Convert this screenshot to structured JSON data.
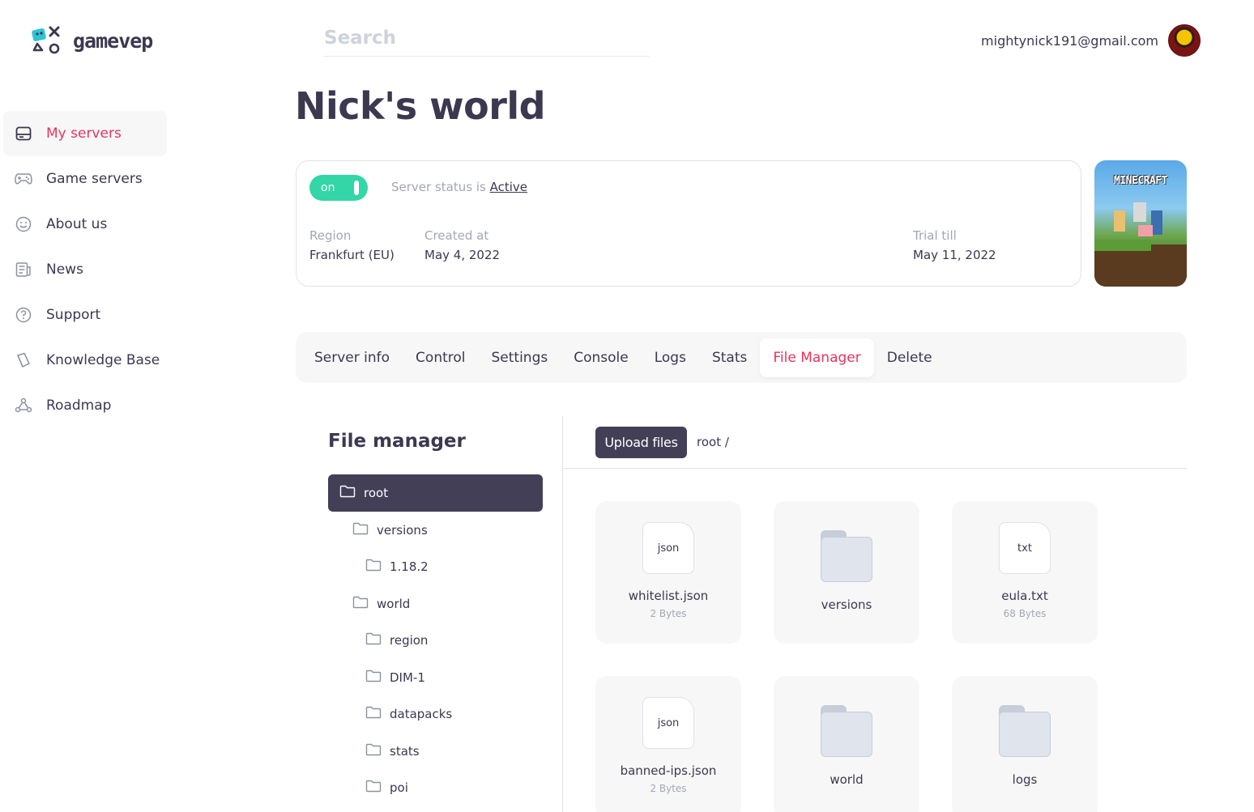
{
  "brand": {
    "name": "gamevep"
  },
  "search": {
    "placeholder": "Search"
  },
  "user": {
    "email": "mightynick191@gmail.com"
  },
  "sidebar": {
    "items": [
      {
        "label": "My servers",
        "icon": "server-icon",
        "active": true
      },
      {
        "label": "Game servers",
        "icon": "gamepad-icon",
        "active": false
      },
      {
        "label": "About us",
        "icon": "smile-icon",
        "active": false
      },
      {
        "label": "News",
        "icon": "newspaper-icon",
        "active": false
      },
      {
        "label": "Support",
        "icon": "question-icon",
        "active": false
      },
      {
        "label": "Knowledge Base",
        "icon": "book-icon",
        "active": false
      },
      {
        "label": "Roadmap",
        "icon": "roadmap-icon",
        "active": false
      }
    ]
  },
  "page": {
    "title": "Nick's world"
  },
  "server": {
    "toggle_label": "on",
    "status_prefix": "Server status is",
    "status_value": "Active",
    "region_label": "Region",
    "region_value": "Frankfurt (EU)",
    "created_label": "Created at",
    "created_value": "May 4, 2022",
    "trial_label": "Trial till",
    "trial_value": "May 11, 2022",
    "game_art_title": "MINECRAFT"
  },
  "tabs": [
    {
      "label": "Server info",
      "active": false
    },
    {
      "label": "Control",
      "active": false
    },
    {
      "label": "Settings",
      "active": false
    },
    {
      "label": "Console",
      "active": false
    },
    {
      "label": "Logs",
      "active": false
    },
    {
      "label": "Stats",
      "active": false
    },
    {
      "label": "File Manager",
      "active": true
    },
    {
      "label": "Delete",
      "active": false
    }
  ],
  "file_manager": {
    "title": "File manager",
    "upload_label": "Upload files",
    "path": "root /",
    "tree": [
      {
        "label": "root",
        "level": 0
      },
      {
        "label": "versions",
        "level": 1
      },
      {
        "label": "1.18.2",
        "level": 2
      },
      {
        "label": "world",
        "level": 1
      },
      {
        "label": "region",
        "level": 2
      },
      {
        "label": "DIM-1",
        "level": 2
      },
      {
        "label": "datapacks",
        "level": 2
      },
      {
        "label": "stats",
        "level": 2
      },
      {
        "label": "poi",
        "level": 2
      }
    ],
    "items": [
      {
        "type": "file",
        "ext": "json",
        "name": "whitelist.json",
        "size": "2 Bytes"
      },
      {
        "type": "folder",
        "name": "versions"
      },
      {
        "type": "file",
        "ext": "txt",
        "name": "eula.txt",
        "size": "68 Bytes"
      },
      {
        "type": "file",
        "ext": "json",
        "name": "banned-ips.json",
        "size": "2 Bytes"
      },
      {
        "type": "folder",
        "name": "world"
      },
      {
        "type": "folder",
        "name": "logs"
      }
    ]
  },
  "colors": {
    "accent": "#e8345d",
    "dark": "#423f56",
    "active_green": "#33d6a6",
    "muted": "#a4a7b4"
  }
}
